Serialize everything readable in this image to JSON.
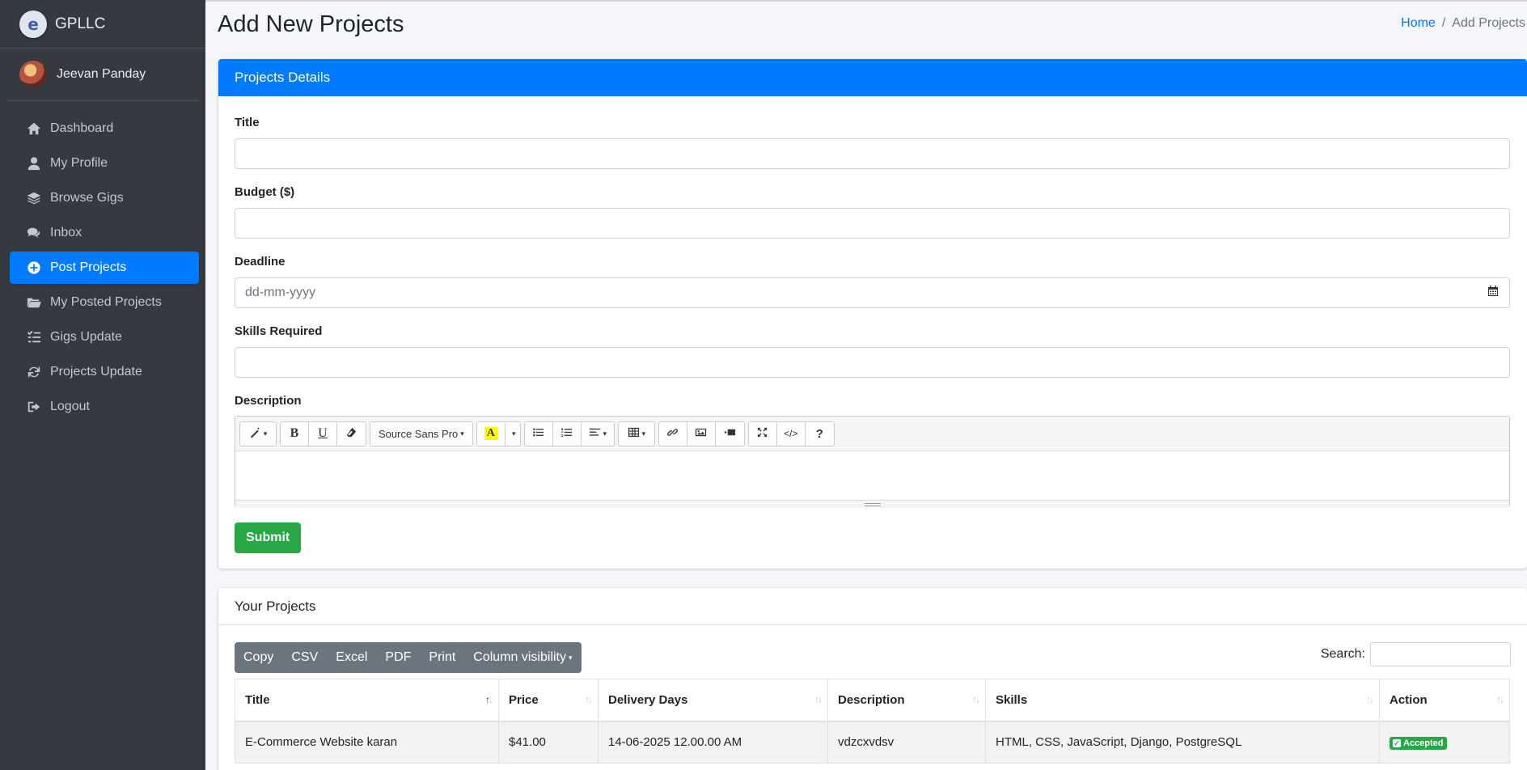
{
  "brand": {
    "name": "GPLLC",
    "logo_letter": "e"
  },
  "user": {
    "name": "Jeevan Panday"
  },
  "sidebar": {
    "items": [
      {
        "label": "Dashboard",
        "icon": "home-icon"
      },
      {
        "label": "My Profile",
        "icon": "user-icon"
      },
      {
        "label": "Browse Gigs",
        "icon": "layers-icon"
      },
      {
        "label": "Inbox",
        "icon": "comments-icon"
      },
      {
        "label": "Post Projects",
        "icon": "plus-circle-icon",
        "active": true
      },
      {
        "label": "My Posted Projects",
        "icon": "folder-open-icon"
      },
      {
        "label": "Gigs Update",
        "icon": "tasks-icon"
      },
      {
        "label": "Projects Update",
        "icon": "sync-icon"
      },
      {
        "label": "Logout",
        "icon": "sign-out-icon"
      }
    ]
  },
  "header": {
    "title": "Add New Projects",
    "breadcrumb": {
      "home": "Home",
      "separator": "/",
      "current": "Add Projects"
    }
  },
  "form": {
    "card_title": "Projects Details",
    "title_label": "Title",
    "budget_label": "Budget ($)",
    "deadline_label": "Deadline",
    "deadline_placeholder": "dd-mm-yyyy",
    "skills_label": "Skills Required",
    "description_label": "Description",
    "editor": {
      "font_name": "Source Sans Pro",
      "bold": "B",
      "underline": "U",
      "help": "?"
    },
    "submit_label": "Submit"
  },
  "projects": {
    "card_title": "Your Projects",
    "buttons": [
      "Copy",
      "CSV",
      "Excel",
      "PDF",
      "Print",
      "Column visibility"
    ],
    "search_label": "Search:",
    "columns": [
      "Title",
      "Price",
      "Delivery Days",
      "Description",
      "Skills",
      "Action"
    ],
    "rows": [
      {
        "title": "E-Commerce Website karan",
        "price": "$41.00",
        "delivery": "14-06-2025 12.00.00 AM",
        "description": "vdzcxvdsv",
        "skills": "HTML, CSS, JavaScript, Django, PostgreSQL",
        "action": "Accepted"
      }
    ]
  },
  "colors": {
    "primary": "#007bff",
    "success": "#28a745",
    "sidebar": "#343a40",
    "secondary": "#6c757d"
  }
}
